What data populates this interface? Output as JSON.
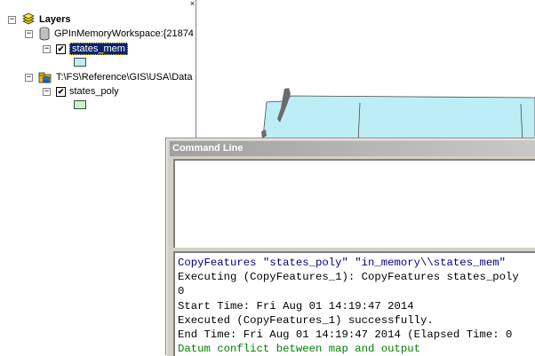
{
  "toc": {
    "close_glyph": "×",
    "root": {
      "expander": "−",
      "label": "Layers",
      "icon": "layers-stack-icon"
    },
    "groups": [
      {
        "expander": "−",
        "icon": "database-icon",
        "label": "GPInMemoryWorkspace:{21874",
        "layer": {
          "expander": "−",
          "checked": "✔",
          "label": "states_mem",
          "selected": true,
          "swatch_color": "#bdeef5"
        }
      },
      {
        "expander": "−",
        "icon": "folder-database-icon",
        "label": "T:\\FS\\Reference\\GIS\\USA\\Data",
        "layer": {
          "expander": "−",
          "checked": "✔",
          "label": "states_poly",
          "selected": false,
          "swatch_color": "#c8f5c8"
        }
      }
    ]
  },
  "map": {
    "land_color": "#bdeef5",
    "border_color": "#4a4a4a",
    "island_color": "#6b6b6b"
  },
  "command_line": {
    "title": "Command Line",
    "input_value": "",
    "output": [
      {
        "text": "CopyFeatures \"states_poly\" \"in_memory\\\\states_mem\"",
        "color": "#000080"
      },
      {
        "text": "Executing (CopyFeatures_1): CopyFeatures states_poly",
        "color": "#000000"
      },
      {
        "text": "0",
        "color": "#000000"
      },
      {
        "text": "Start Time: Fri Aug 01 14:19:47 2014",
        "color": "#000000"
      },
      {
        "text": "Executed (CopyFeatures_1) successfully.",
        "color": "#000000"
      },
      {
        "text": "End Time: Fri Aug 01 14:19:47 2014 (Elapsed Time: 0",
        "color": "#000000"
      },
      {
        "text": "Datum conflict between map and output",
        "color": "#008000"
      }
    ]
  }
}
